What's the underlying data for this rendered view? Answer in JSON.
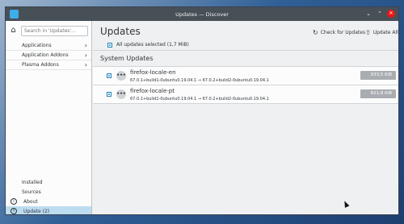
{
  "window": {
    "title": "Updates — Discover"
  },
  "sidebar": {
    "search_placeholder": "Search in 'Updates'...",
    "categories": [
      {
        "label": "Applications"
      },
      {
        "label": "Application Addons"
      },
      {
        "label": "Plasma Addons"
      }
    ],
    "links": [
      {
        "label": "Installed"
      },
      {
        "label": "Sources"
      },
      {
        "label": "About"
      },
      {
        "label": "Update (2)"
      }
    ]
  },
  "main": {
    "title": "Updates",
    "check_updates_label": "Check for Updates",
    "update_all_label": "Update All",
    "select_all_label": "All updates selected (1,7 MiB)",
    "section_title": "System Updates",
    "packages": [
      {
        "name": "firefox-locale-en",
        "version": "67.0.1+build1-0ubuntu0.19.04.1 → 67.0.2+build2-0ubuntu0.19.04.1",
        "size": "933,5 KiB"
      },
      {
        "name": "firefox-locale-pt",
        "version": "67.0.1+build1-0ubuntu0.19.04.1 → 67.0.2+build2-0ubuntu0.19.04.1",
        "size": "821,8 KiB"
      }
    ]
  },
  "colors": {
    "accent": "#3daee9",
    "selected_bg": "#bcdcf0",
    "titlebar": "#475057",
    "size_badge": "#a9adb1"
  }
}
